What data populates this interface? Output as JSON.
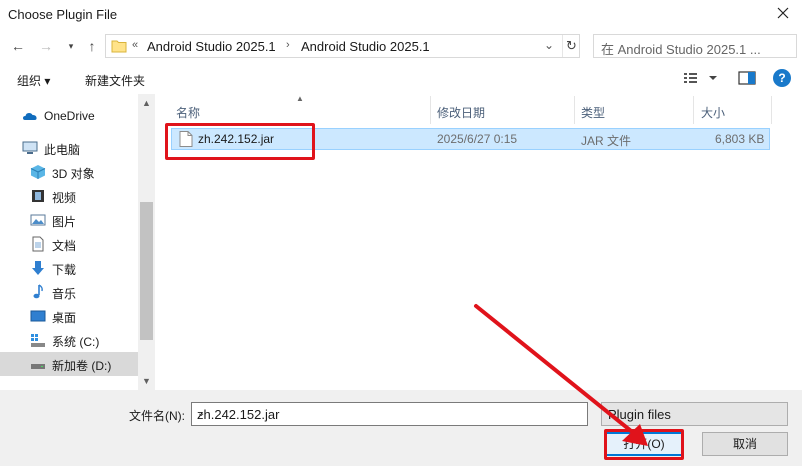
{
  "window": {
    "title": "Choose Plugin File"
  },
  "nav": {
    "back_icon": "arrow-left-icon",
    "forward_icon": "arrow-right-icon",
    "recent_icon": "chevron-down-icon",
    "up_icon": "arrow-up-icon",
    "address_prefix": "«",
    "breadcrumbs": [
      "Android Studio 2025.1",
      "Android Studio 2025.1"
    ],
    "search_placeholder": "在 Android Studio 2025.1 ..."
  },
  "toolbar": {
    "organize": "组织 ▾",
    "new_folder": "新建文件夹"
  },
  "sidebar": {
    "items": [
      {
        "label": "OneDrive",
        "icon": "cloud-icon"
      },
      {
        "label": "此电脑",
        "icon": "computer-icon"
      },
      {
        "label": "3D 对象",
        "icon": "cube-icon"
      },
      {
        "label": "视频",
        "icon": "video-icon"
      },
      {
        "label": "图片",
        "icon": "picture-icon"
      },
      {
        "label": "文档",
        "icon": "document-icon"
      },
      {
        "label": "下载",
        "icon": "download-icon"
      },
      {
        "label": "音乐",
        "icon": "music-icon"
      },
      {
        "label": "桌面",
        "icon": "desktop-icon"
      },
      {
        "label": "系统 (C:)",
        "icon": "drive-icon"
      },
      {
        "label": "新加卷 (D:)",
        "icon": "drive-icon"
      }
    ]
  },
  "columns": {
    "name": "名称",
    "modified": "修改日期",
    "type": "类型",
    "size": "大小"
  },
  "files": [
    {
      "name": "zh.242.152.jar",
      "modified": "2025/6/27 0:15",
      "type": "JAR 文件",
      "size": "6,803 KB"
    }
  ],
  "footer": {
    "filename_label": "文件名(N):",
    "filename_value": "zh.242.152.jar",
    "filetype_value": "Plugin files",
    "open_label": "打开(O)",
    "cancel_label": "取消"
  },
  "colors": {
    "annotation": "#e0131b",
    "selection": "#cce8ff",
    "accent": "#0078d7"
  }
}
